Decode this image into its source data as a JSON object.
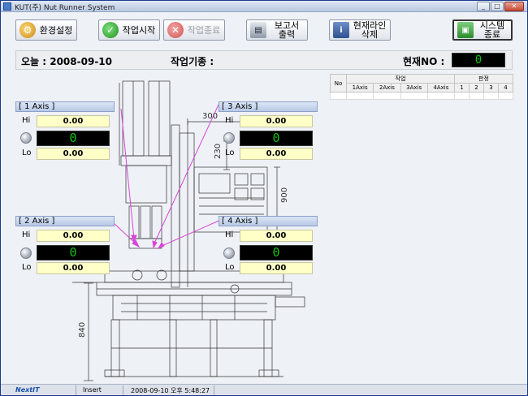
{
  "window": {
    "title": "KUT(주) Nut Runner System"
  },
  "toolbar": {
    "env_settings": "환경설정",
    "work_start": "작업시작",
    "work_stop": "작업종료",
    "report_print": "보고서\n출력",
    "delete_current_line": "현재라인\n삭제",
    "system_exit": "시스템\n종료"
  },
  "datebar": {
    "today_label": "오늘 : 2008-09-10",
    "work_type_label": "작업기종 :",
    "current_no_label": "현재NO :",
    "current_no_value": "0"
  },
  "axes": [
    {
      "title": "[ 1 Axis ]",
      "hi_label": "Hi",
      "hi_value": "0.00",
      "display": "0",
      "lo_label": "Lo",
      "lo_value": "0.00"
    },
    {
      "title": "[ 2 Axis ]",
      "hi_label": "Hi",
      "hi_value": "0.00",
      "display": "0",
      "lo_label": "Lo",
      "lo_value": "0.00"
    },
    {
      "title": "[ 3 Axis ]",
      "hi_label": "Hi",
      "hi_value": "0.00",
      "display": "0",
      "lo_label": "Lo",
      "lo_value": "0.00"
    },
    {
      "title": "[ 4 Axis ]",
      "hi_label": "Hi",
      "hi_value": "0.00",
      "display": "0",
      "lo_label": "Lo",
      "lo_value": "0.00"
    }
  ],
  "drawing": {
    "dim_300": "300",
    "dim_230": "230",
    "dim_900": "900",
    "dim_840": "840"
  },
  "grid": {
    "no_header": "No",
    "work_header": "작업",
    "judge_header": "판정",
    "work_columns": [
      "1Axis",
      "2Axis",
      "3Axis",
      "4Axis"
    ],
    "judge_columns": [
      "1",
      "2",
      "3",
      "4"
    ]
  },
  "statusbar": {
    "brand": "NextIT",
    "mode": "Insert",
    "clock": "2008-09-10 오후 5:48:27"
  },
  "colors": {
    "lcd_text": "#11c211",
    "value_bg": "#ffffc8",
    "brand": "#1a4fa8",
    "arrow": "#d845d8"
  }
}
